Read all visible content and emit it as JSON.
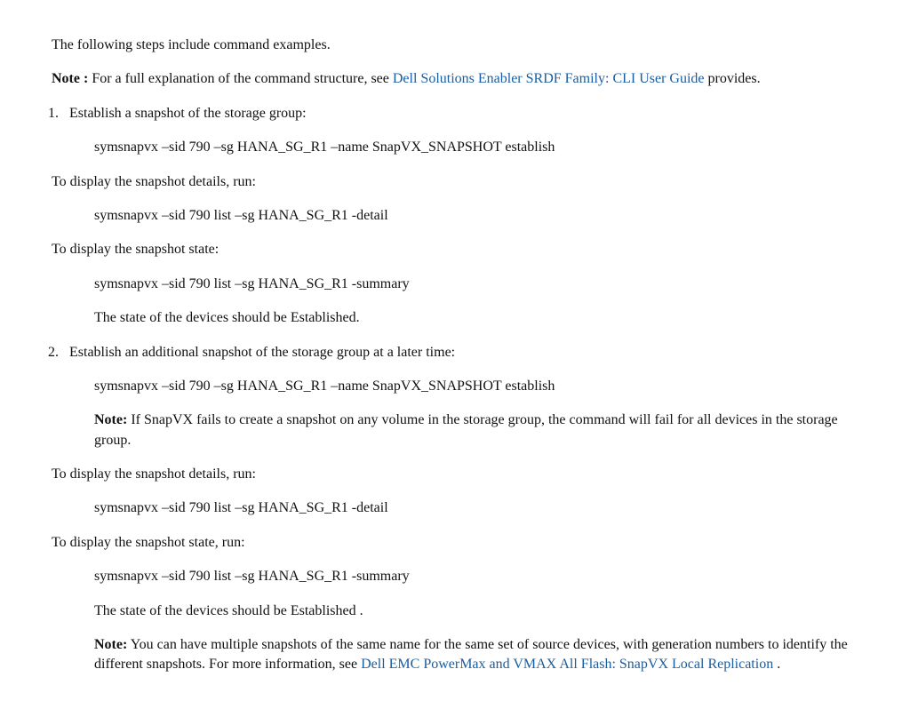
{
  "intro": "The following steps include command examples.",
  "note1_label": "Note :",
  "note1_pre": " For a full explanation of the command structure, see ",
  "note1_link": "Dell Solutions Enabler SRDF Family: CLI User Guide",
  "note1_post": " provides.",
  "step1_num": "1.",
  "step1_text": "Establish a snapshot of the storage group:",
  "cmd1": "symsnapvx –sid 790 –sg HANA_SG_R1 –name SnapVX_SNAPSHOT establish",
  "p_details1": "To display the snapshot details, run:",
  "cmd2": "symsnapvx –sid 790 list –sg HANA_SG_R1 -detail",
  "p_state1": "To display the snapshot state:",
  "cmd3": "symsnapvx –sid 790 list –sg HANA_SG_R1 -summary",
  "established1": "The state of the devices should be Established.",
  "step2_num": "2.",
  "step2_text": "Establish an additional snapshot of the storage group at a later time:",
  "cmd4": "symsnapvx –sid 790 –sg HANA_SG_R1 –name SnapVX_SNAPSHOT establish",
  "note2_label": "Note:",
  "note2_text": " If SnapVX fails to create a snapshot on any volume in the storage group, the command will fail for all devices in the storage group.",
  "p_details2": "To display the snapshot details, run:",
  "cmd5": "symsnapvx –sid 790 list –sg HANA_SG_R1 -detail",
  "p_state2": "To display the snapshot state, run:",
  "cmd6": "symsnapvx –sid 790 list –sg HANA_SG_R1 -summary",
  "established2": "The state of the devices should be Established .",
  "note3_label": "Note:",
  "note3_pre": " You can have multiple snapshots of the same name for the same set of source devices, with generation numbers to identify the different snapshots. For more information, see ",
  "note3_link": "Dell EMC PowerMax and VMAX All Flash: SnapVX Local Replication",
  "note3_post": " ."
}
